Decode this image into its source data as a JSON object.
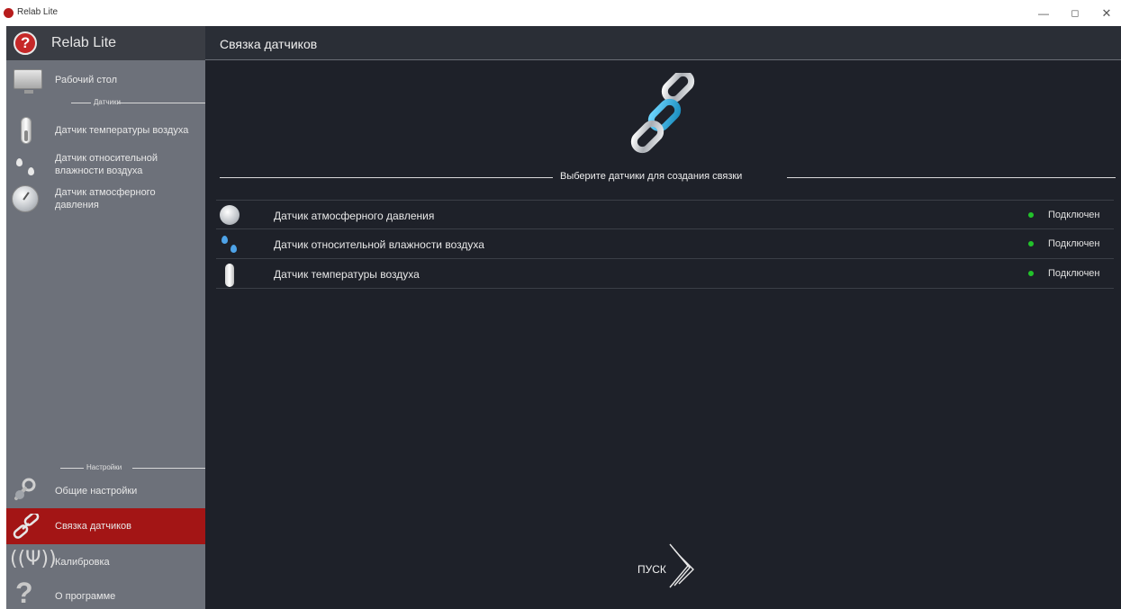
{
  "window": {
    "title": "Relab Lite",
    "minimize": "—",
    "maximize": "◻",
    "close": "✕"
  },
  "sidebar": {
    "brand": "Relab Lite",
    "desktop_label": "Рабочий стол",
    "sensors_section": "Датчики",
    "sensors": [
      {
        "label": "Датчик температуры воздуха",
        "icon": "thermometer-icon"
      },
      {
        "label": "Датчик относительной влажности воздуха",
        "icon": "drops-icon"
      },
      {
        "label": "Датчик атмосферного давления",
        "icon": "gauge-icon"
      }
    ],
    "settings_section": "Настройки",
    "settings": [
      {
        "label": "Общие настройки",
        "icon": "magnifier-icon"
      },
      {
        "label": "Связка датчиков",
        "icon": "chain-icon",
        "active": true
      },
      {
        "label": "Калибровка",
        "icon": "calibration-icon"
      },
      {
        "label": "О программе",
        "icon": "question-icon"
      }
    ]
  },
  "main": {
    "title": "Связка датчиков",
    "select_prompt": "Выберите датчики для создания связки",
    "rows": [
      {
        "name": "Датчик атмосферного давления",
        "status": "Подключен",
        "icon": "gauge-icon"
      },
      {
        "name": "Датчик относительной влажности воздуха",
        "status": "Подключен",
        "icon": "drops-icon"
      },
      {
        "name": "Датчик температуры воздуха",
        "status": "Подключен",
        "icon": "thermometer-icon"
      }
    ],
    "start_label": "ПУСК"
  },
  "colors": {
    "accent_active": "#a31515",
    "status_ok": "#22c32a",
    "main_bg": "#1e2129",
    "sidebar_bg": "#6d717a"
  }
}
